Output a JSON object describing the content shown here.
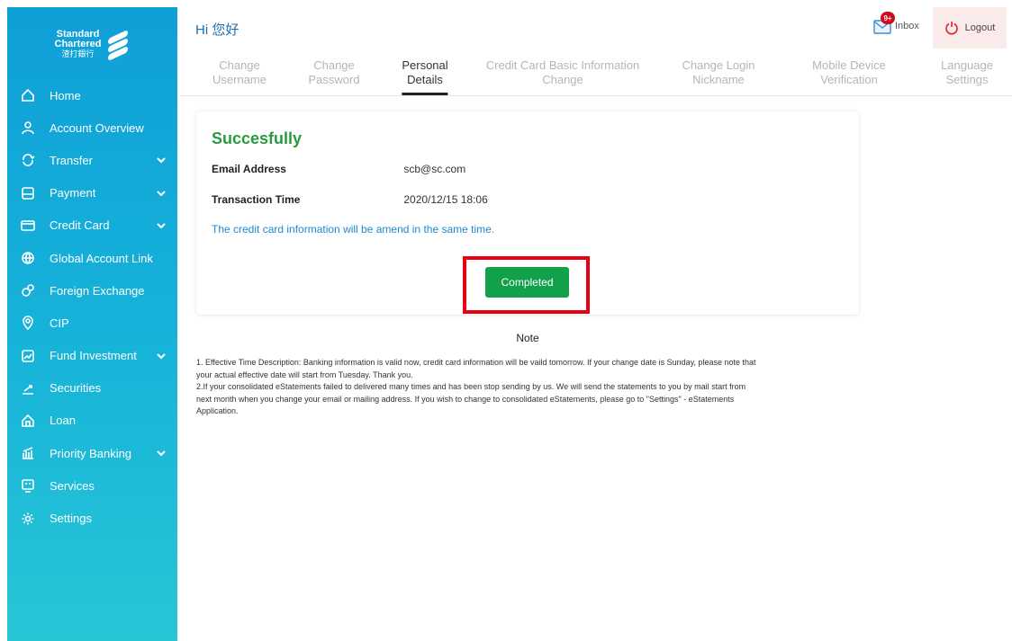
{
  "logo": {
    "line1": "Standard",
    "line2": "Chartered",
    "line3": "渣打銀行"
  },
  "sidebar": {
    "items": [
      {
        "label": "Home",
        "icon": "home-icon",
        "expandable": false
      },
      {
        "label": "Account Overview",
        "icon": "person-icon",
        "expandable": false
      },
      {
        "label": "Transfer",
        "icon": "transfer-icon",
        "expandable": true
      },
      {
        "label": "Payment",
        "icon": "payment-icon",
        "expandable": true
      },
      {
        "label": "Credit Card",
        "icon": "credit-card-icon",
        "expandable": true
      },
      {
        "label": "Global Account Link",
        "icon": "globe-icon",
        "expandable": false
      },
      {
        "label": "Foreign Exchange",
        "icon": "exchange-icon",
        "expandable": false
      },
      {
        "label": "CIP",
        "icon": "cip-icon",
        "expandable": false
      },
      {
        "label": "Fund Investment",
        "icon": "fund-icon",
        "expandable": true
      },
      {
        "label": "Securities",
        "icon": "securities-icon",
        "expandable": false
      },
      {
        "label": "Loan",
        "icon": "loan-icon",
        "expandable": false
      },
      {
        "label": "Priority Banking",
        "icon": "priority-banking-icon",
        "expandable": true
      },
      {
        "label": "Services",
        "icon": "services-icon",
        "expandable": false
      },
      {
        "label": "Settings",
        "icon": "gear-icon",
        "expandable": false
      }
    ]
  },
  "header": {
    "greeting": "Hi 您好",
    "inbox_label": "Inbox",
    "inbox_badge": "9+",
    "logout_label": "Logout"
  },
  "tabs": [
    {
      "line1": "Change",
      "line2": "Username",
      "active": false
    },
    {
      "line1": "Change",
      "line2": "Password",
      "active": false
    },
    {
      "line1": "Personal",
      "line2": "Details",
      "active": true
    },
    {
      "line1": "Credit Card Basic Information",
      "line2": "Change",
      "active": false
    },
    {
      "line1": "Change Login",
      "line2": "Nickname",
      "active": false
    },
    {
      "line1": "Mobile Device",
      "line2": "Verification",
      "active": false
    },
    {
      "line1": "Language",
      "line2": "Settings",
      "active": false
    }
  ],
  "result": {
    "title": "Succesfully",
    "email_label": "Email Address",
    "email_value": "scb@sc.com",
    "time_label": "Transaction Time",
    "time_value": "2020/12/15 18:06",
    "info": "The credit card information will be amend in the same time.",
    "button": "Completed"
  },
  "note": {
    "title": "Note",
    "line1": "1. Effective Time Description: Banking information is valid now, credit card information will be vaild tomorrow. If your change date is Sunday, please note that",
    "line2": "your actual effective date will start from Tuesday. Thank you.",
    "line3": "2.If your consolidated eStatements failed to delivered many times and has been stop sending by us. We will send the statements to you by mail start from",
    "line4": "next month when you change your email or mailing address. If you wish to change to consolidated eStatements, please go to \"Settings\" -  eStatements",
    "line5": "Application."
  },
  "colors": {
    "sidebar_top": "#0f9fd8",
    "sidebar_bottom": "#27c6d6",
    "success_green": "#2a9a3e",
    "button_green": "#12a04a",
    "link_blue": "#1a8ad4",
    "highlight_red": "#e60012"
  }
}
